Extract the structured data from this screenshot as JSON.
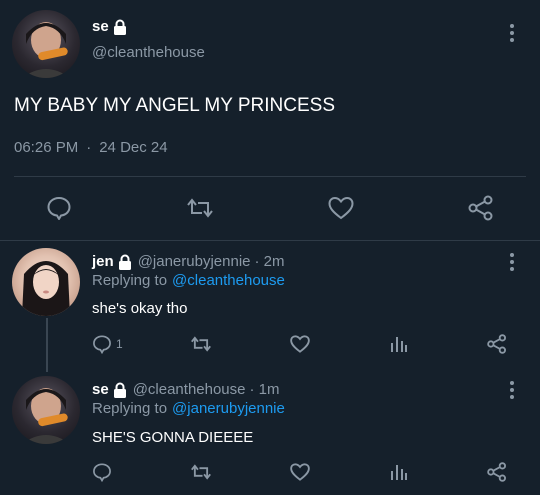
{
  "main_tweet": {
    "display_name": "se",
    "handle": "@cleanthehouse",
    "text": "MY BABY MY ANGEL MY PRINCESS",
    "time": "06:26 PM",
    "separator": "·",
    "date": "24 Dec 24"
  },
  "reply_1": {
    "display_name": "jen",
    "handle": "@janerubyjennie",
    "age": "· 2m",
    "replying_prefix": "Replying to",
    "replying_to": "@cleanthehouse",
    "text": "she's okay tho",
    "reply_count": "1"
  },
  "reply_2": {
    "display_name": "se",
    "handle": "@cleanthehouse",
    "age": "· 1m",
    "replying_prefix": "Replying to",
    "replying_to": "@janerubyjennie",
    "text": "SHE'S GONNA DIEEEE"
  },
  "icons": {
    "lock": "lock-icon",
    "reply": "comment-icon",
    "retweet": "retweet-icon",
    "like": "heart-icon",
    "share": "share-icon",
    "analytics": "analytics-icon",
    "more": "more-vertical-icon"
  },
  "colors": {
    "background": "#15202b",
    "muted": "#8b98a5",
    "link": "#1d9bf0",
    "divider": "#2f3b47"
  }
}
